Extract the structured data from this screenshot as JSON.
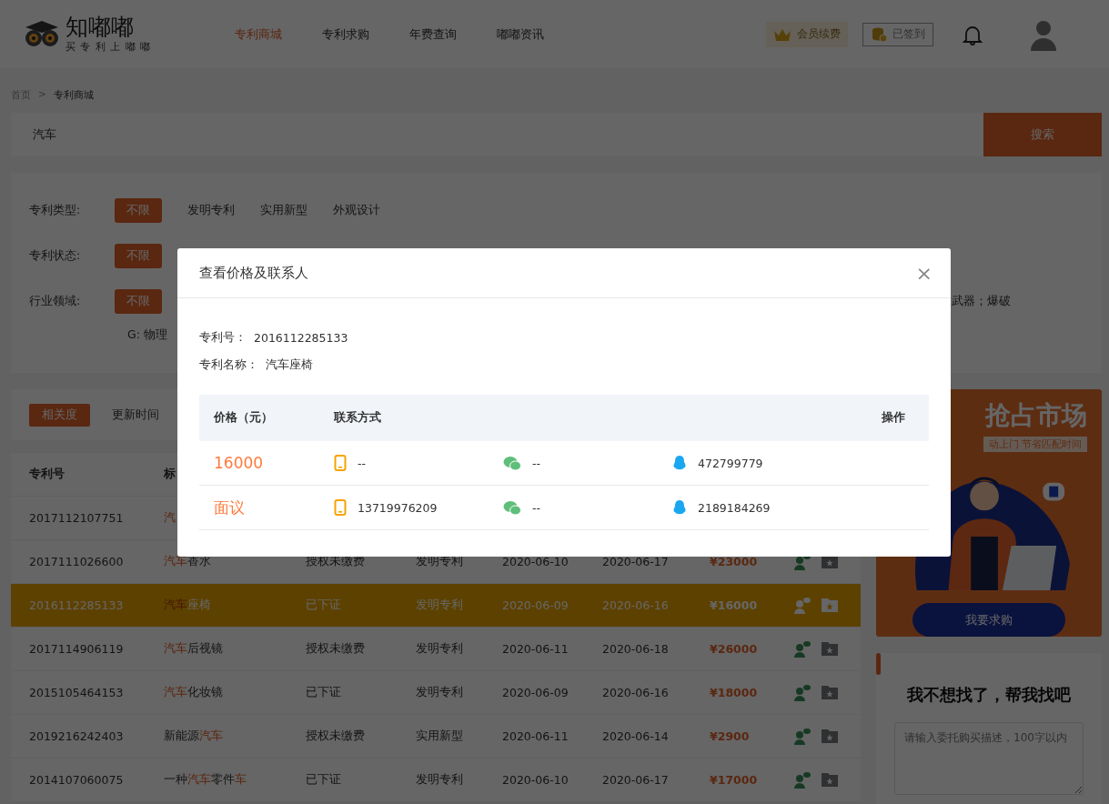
{
  "header": {
    "logo_name": "知嘟嘟",
    "slogan": "买 专 利 上 嘟 嘟",
    "nav": [
      {
        "label": "专利商城",
        "selected": true
      },
      {
        "label": "专利求购",
        "selected": false
      },
      {
        "label": "年费查询",
        "selected": false
      },
      {
        "label": "嘟嘟资讯",
        "selected": false
      }
    ],
    "member_button": "会员续费",
    "signin_button": "已签到"
  },
  "breadcrumb": [
    "首页",
    ">",
    "专利商城"
  ],
  "search": {
    "value": "汽车",
    "button": "搜索"
  },
  "filters": [
    {
      "label": "专利类型:",
      "options": [
        {
          "label": "不限",
          "selected": true
        },
        {
          "label": "发明专利",
          "selected": false
        },
        {
          "label": "实用新型",
          "selected": false
        },
        {
          "label": "外观设计",
          "selected": false
        }
      ]
    },
    {
      "label": "专利状态:",
      "options": [
        {
          "label": "不限",
          "selected": true
        }
      ]
    },
    {
      "label": "行业领域:",
      "options": [
        {
          "label": "不限",
          "selected": true
        },
        {
          "label": "武器；爆破",
          "selected": false
        }
      ],
      "second_line": "G: 物理"
    }
  ],
  "sort": [
    {
      "label": "相关度",
      "selected": true
    },
    {
      "label": "更新时间",
      "selected": false
    }
  ],
  "table": {
    "columns": [
      "专利号",
      "标"
    ],
    "rows": [
      {
        "number": "2017112107751",
        "title": [
          {
            "text": "汽",
            "highlight": true
          }
        ],
        "selected": false
      },
      {
        "number": "2017111026600",
        "title": [
          {
            "text": "汽车",
            "highlight": true
          },
          {
            "text": "香水",
            "highlight": false
          }
        ],
        "status": "授权未缴费",
        "type": "发明专利",
        "date_1": "2020-06-10",
        "date_2": "2020-06-17",
        "price": "¥23000",
        "selected": false
      },
      {
        "number": "2016112285133",
        "title": [
          {
            "text": "汽车",
            "highlight": true
          },
          {
            "text": "座椅",
            "highlight": false
          }
        ],
        "status": "已下证",
        "type": "发明专利",
        "date_1": "2020-06-09",
        "date_2": "2020-06-16",
        "price": "¥16000",
        "selected": true
      },
      {
        "number": "2017114906119",
        "title": [
          {
            "text": "汽车",
            "highlight": true
          },
          {
            "text": "后视镜",
            "highlight": false
          }
        ],
        "status": "授权未缴费",
        "type": "发明专利",
        "date_1": "2020-06-11",
        "date_2": "2020-06-18",
        "price": "¥26000",
        "selected": false
      },
      {
        "number": "2015105464153",
        "title": [
          {
            "text": "汽车",
            "highlight": true
          },
          {
            "text": "化妆镜",
            "highlight": false
          }
        ],
        "status": "已下证",
        "type": "发明专利",
        "date_1": "2020-06-09",
        "date_2": "2020-06-16",
        "price": "¥18000",
        "selected": false
      },
      {
        "number": "2019216242403",
        "title": [
          {
            "text": "新能源",
            "highlight": false
          },
          {
            "text": "汽车",
            "highlight": true
          }
        ],
        "status": "授权未缴费",
        "type": "实用新型",
        "date_1": "2020-06-11",
        "date_2": "2020-06-14",
        "price": "¥2900",
        "selected": false
      },
      {
        "number": "2014107060075",
        "title": [
          {
            "text": "一种",
            "highlight": false
          },
          {
            "text": "汽车",
            "highlight": true
          },
          {
            "text": "零件",
            "highlight": false
          },
          {
            "text": "车",
            "highlight": true
          }
        ],
        "status": "已下证",
        "type": "发明专利",
        "date_1": "2020-06-10",
        "date_2": "2020-06-17",
        "price": "¥17000",
        "selected": false
      }
    ]
  },
  "promo": {
    "headline": "抢占市场",
    "subline": "动上门 节省匹配时间",
    "button": "我要求购"
  },
  "request_card": {
    "title": "我不想找了，帮我找吧",
    "placeholder": "请输入委托购买描述，100字以内"
  },
  "dialog": {
    "title": "查看价格及联系人",
    "close": "×",
    "fields": [
      {
        "label": "专利号：",
        "value": "2016112285133"
      },
      {
        "label": "专利名称：",
        "value": "汽车座椅"
      }
    ],
    "columns": [
      "价格（元）",
      "联系方式",
      "操作"
    ],
    "rows": [
      {
        "price": "16000",
        "phone": "--",
        "wechat": "--",
        "qq": "472799779"
      },
      {
        "price": "面议",
        "phone": "13719976209",
        "wechat": "--",
        "qq": "2189184269"
      }
    ]
  }
}
